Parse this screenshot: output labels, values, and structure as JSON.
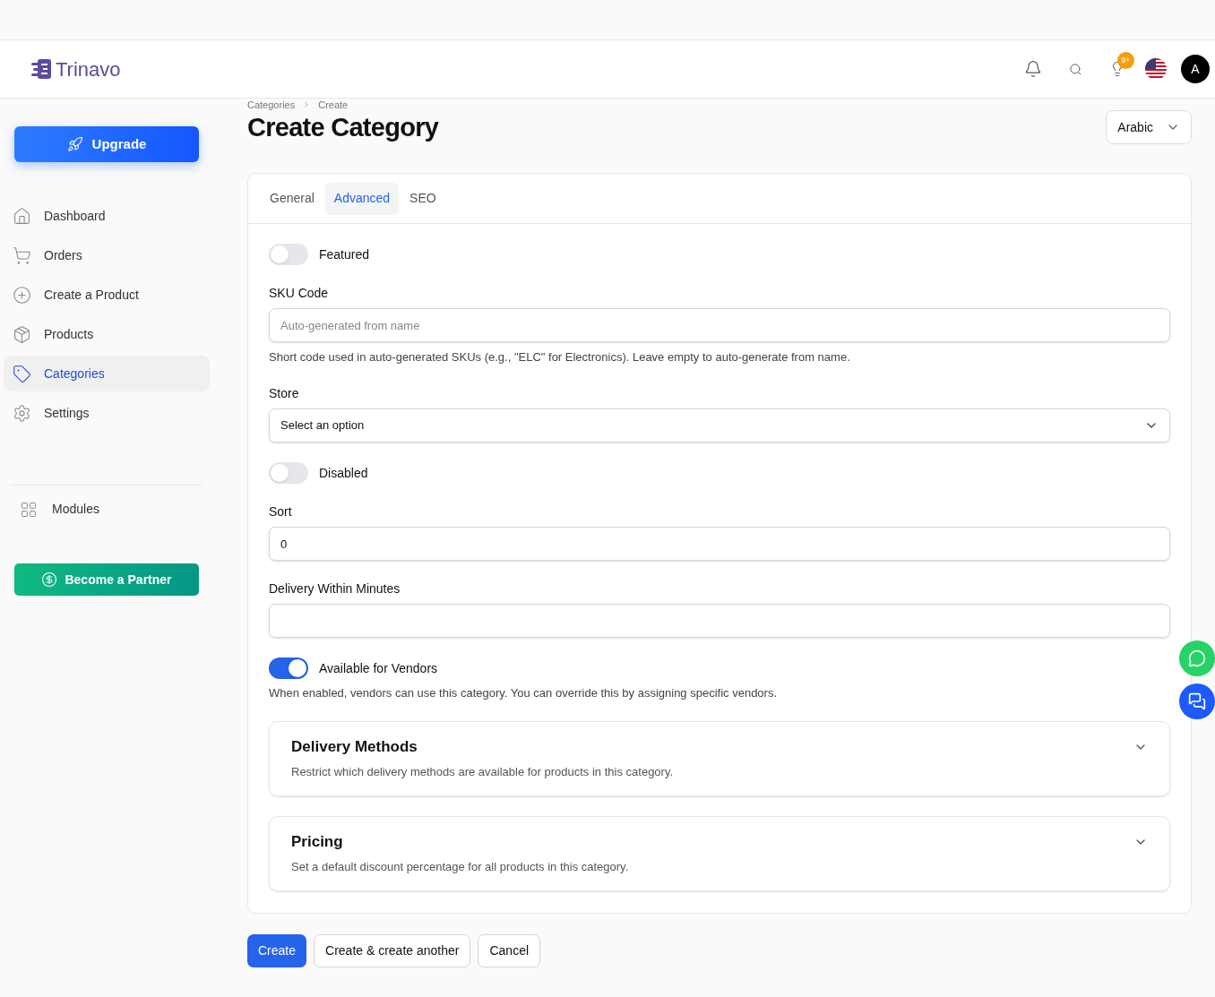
{
  "header": {
    "brand": "Trinavo",
    "notification_badge": "9+",
    "avatar": "A"
  },
  "sidebar": {
    "upgrade": "Upgrade",
    "items": [
      {
        "label": "Dashboard",
        "selected": false
      },
      {
        "label": "Orders",
        "selected": false
      },
      {
        "label": "Create a Product",
        "selected": false
      },
      {
        "label": "Products",
        "selected": false
      },
      {
        "label": "Categories",
        "selected": true
      },
      {
        "label": "Settings",
        "selected": false
      }
    ],
    "modules": "Modules",
    "partner": "Become a Partner"
  },
  "breadcrumb": [
    "Categories",
    "Create"
  ],
  "title": "Create Category",
  "language": "Arabic",
  "tabs": [
    {
      "label": "General",
      "selected": false
    },
    {
      "label": "Advanced",
      "selected": true
    },
    {
      "label": "SEO",
      "selected": false
    }
  ],
  "fields": [
    {
      "kind": "toggle",
      "label": "Featured",
      "on": false
    },
    {
      "kind": "input",
      "label": "SKU Code",
      "placeholder": "Auto-generated from name",
      "help": "Short code used in auto-generated SKUs (e.g., \"ELC\" for Electronics). Leave empty to auto-generate from name."
    },
    {
      "kind": "select",
      "label": "Store",
      "value": "Select an option"
    },
    {
      "kind": "toggle",
      "label": "Disabled",
      "on": false
    },
    {
      "kind": "input",
      "label": "Sort",
      "value": "0"
    },
    {
      "kind": "input",
      "label": "Delivery Within Minutes"
    },
    {
      "kind": "toggle",
      "label": "Available for Vendors",
      "on": true,
      "help": "When enabled, vendors can use this category. You can override this by assigning specific vendors."
    }
  ],
  "sections": [
    {
      "title": "Delivery Methods",
      "description": "Restrict which delivery methods are available for products in this category.",
      "expanded": false
    },
    {
      "title": "Pricing",
      "description": "Set a default discount percentage for all products in this category.",
      "expanded": false
    }
  ],
  "actions": [
    {
      "label": "Create",
      "kind": "primary"
    },
    {
      "label": "Create & create another",
      "kind": "secondary"
    },
    {
      "label": "Cancel",
      "kind": "secondary"
    }
  ]
}
